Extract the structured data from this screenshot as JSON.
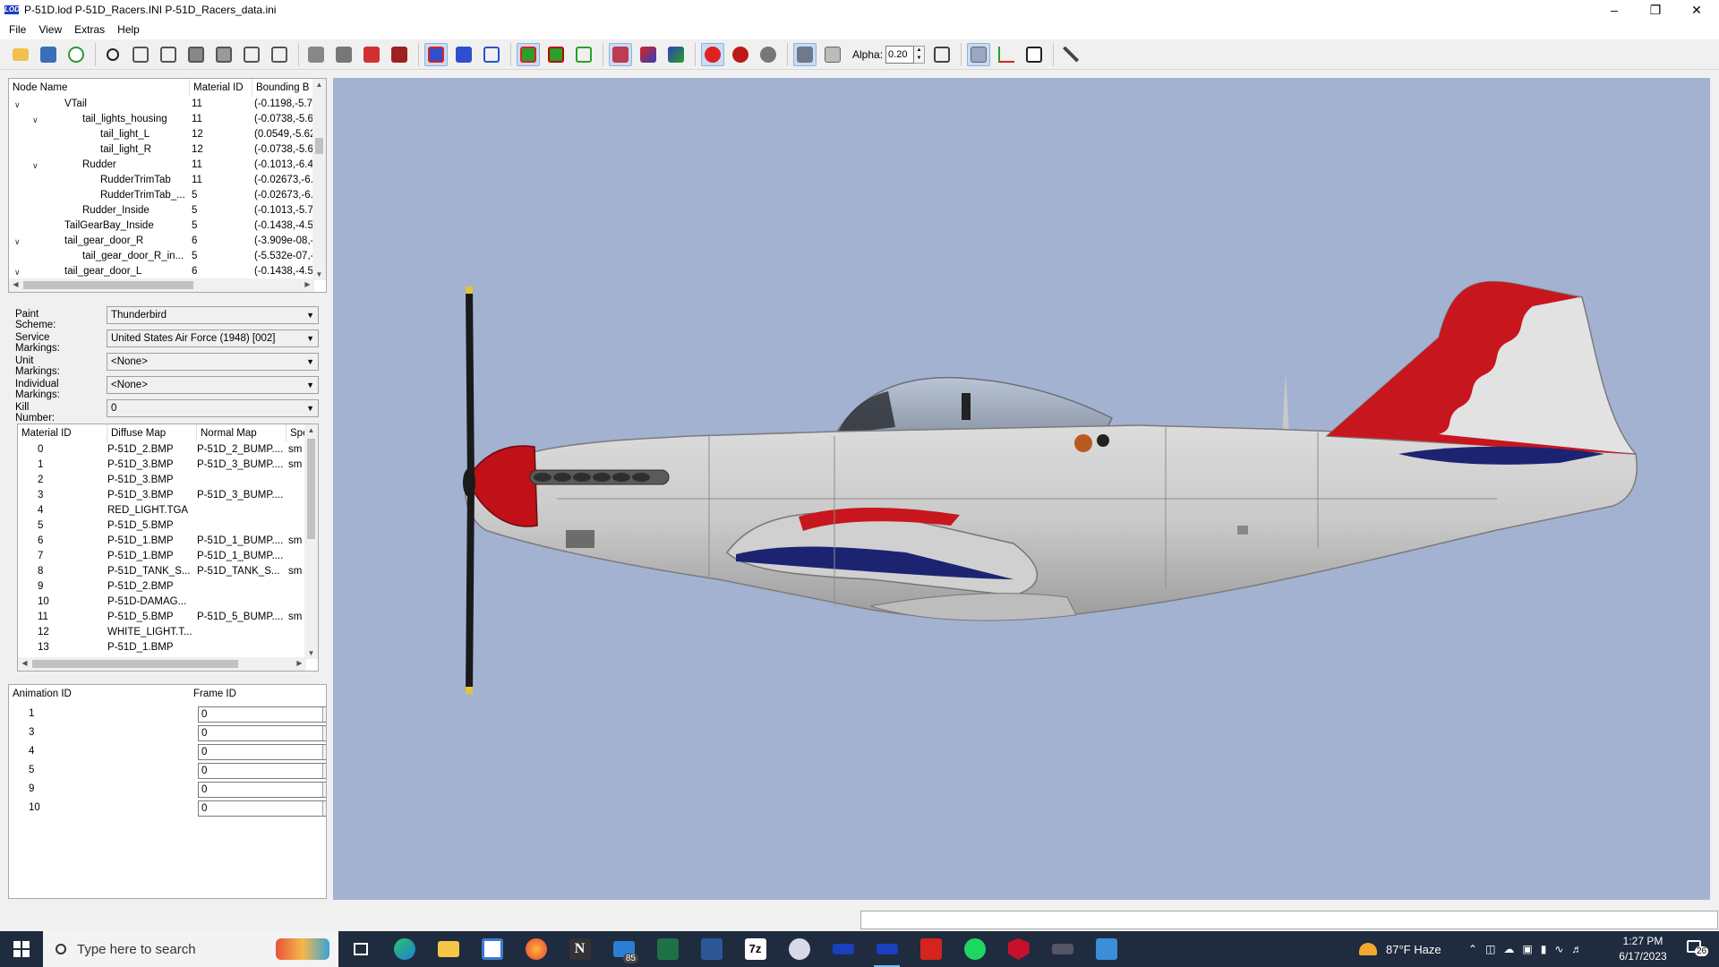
{
  "window": {
    "title": "P-51D.lod  P-51D_Racers.INI  P-51D_Racers_data.ini",
    "logo_text": "LOD"
  },
  "menu": [
    "File",
    "View",
    "Extras",
    "Help"
  ],
  "toolbar": {
    "alpha_label": "Alpha:",
    "alpha_value": "0.20"
  },
  "node_tree": {
    "columns": [
      "Node Name",
      "Material ID",
      "Bounding B"
    ],
    "rows": [
      {
        "name": "VTail",
        "material": "11",
        "bounds": "(-0.1198,-5.7",
        "depth": 2,
        "expanded": true
      },
      {
        "name": "tail_lights_housing",
        "material": "11",
        "bounds": "(-0.0738,-5.6",
        "depth": 3,
        "expanded": true
      },
      {
        "name": "tail_light_L",
        "material": "12",
        "bounds": "(0.0549,-5.62",
        "depth": 4
      },
      {
        "name": "tail_light_R",
        "material": "12",
        "bounds": "(-0.0738,-5.6",
        "depth": 4
      },
      {
        "name": "Rudder",
        "material": "11",
        "bounds": "(-0.1013,-6.4",
        "depth": 3,
        "expanded": true
      },
      {
        "name": "RudderTrimTab",
        "material": "11",
        "bounds": "(-0.02673,-6.",
        "depth": 4
      },
      {
        "name": "RudderTrimTab_...",
        "material": "5",
        "bounds": "(-0.02673,-6.",
        "depth": 4
      },
      {
        "name": "Rudder_Inside",
        "material": "5",
        "bounds": "(-0.1013,-5.7",
        "depth": 3
      },
      {
        "name": "TailGearBay_Inside",
        "material": "5",
        "bounds": "(-0.1438,-4.5",
        "depth": 2
      },
      {
        "name": "tail_gear_door_R",
        "material": "6",
        "bounds": "(-3.909e-08,-",
        "depth": 2,
        "expanded": true
      },
      {
        "name": "tail_gear_door_R_in...",
        "material": "5",
        "bounds": "(-5.532e-07,-",
        "depth": 3
      },
      {
        "name": "tail_gear_door_L",
        "material": "6",
        "bounds": "(-0.1438,-4.5",
        "depth": 2,
        "expanded": true
      }
    ]
  },
  "markings": {
    "paint_scheme_label": "Paint Scheme:",
    "paint_scheme": "Thunderbird",
    "service_label": "Service Markings:",
    "service": "United States Air Force (1948) [002]",
    "unit_label": "Unit Markings:",
    "unit": "<None>",
    "individual_label": "Individual Markings:",
    "individual": "<None>",
    "kill_label": "Kill Number:",
    "kill": "0"
  },
  "materials": {
    "columns": [
      "Material ID",
      "Diffuse Map",
      "Normal Map",
      "Spe"
    ],
    "rows": [
      {
        "id": "0",
        "diffuse": "P-51D_2.BMP",
        "normal": "P-51D_2_BUMP....",
        "spec": "sm"
      },
      {
        "id": "1",
        "diffuse": "P-51D_3.BMP",
        "normal": "P-51D_3_BUMP....",
        "spec": "sm"
      },
      {
        "id": "2",
        "diffuse": "P-51D_3.BMP",
        "normal": "",
        "spec": ""
      },
      {
        "id": "3",
        "diffuse": "P-51D_3.BMP",
        "normal": "P-51D_3_BUMP....",
        "spec": ""
      },
      {
        "id": "4",
        "diffuse": "RED_LIGHT.TGA",
        "normal": "",
        "spec": ""
      },
      {
        "id": "5",
        "diffuse": "P-51D_5.BMP",
        "normal": "",
        "spec": ""
      },
      {
        "id": "6",
        "diffuse": "P-51D_1.BMP",
        "normal": "P-51D_1_BUMP....",
        "spec": "sm"
      },
      {
        "id": "7",
        "diffuse": "P-51D_1.BMP",
        "normal": "P-51D_1_BUMP....",
        "spec": ""
      },
      {
        "id": "8",
        "diffuse": "P-51D_TANK_S...",
        "normal": "P-51D_TANK_S...",
        "spec": "sm"
      },
      {
        "id": "9",
        "diffuse": "P-51D_2.BMP",
        "normal": "",
        "spec": ""
      },
      {
        "id": "10",
        "diffuse": "P-51D-DAMAG...",
        "normal": "",
        "spec": ""
      },
      {
        "id": "11",
        "diffuse": "P-51D_5.BMP",
        "normal": "P-51D_5_BUMP....",
        "spec": "sm"
      },
      {
        "id": "12",
        "diffuse": "WHITE_LIGHT.T...",
        "normal": "",
        "spec": ""
      },
      {
        "id": "13",
        "diffuse": "P-51D_1.BMP",
        "normal": "",
        "spec": ""
      }
    ]
  },
  "animations": {
    "columns": [
      "Animation ID",
      "Frame ID"
    ],
    "rows": [
      {
        "id": "1",
        "frame": "0"
      },
      {
        "id": "3",
        "frame": "0"
      },
      {
        "id": "4",
        "frame": "0"
      },
      {
        "id": "5",
        "frame": "0"
      },
      {
        "id": "9",
        "frame": "0"
      },
      {
        "id": "10",
        "frame": "0"
      }
    ]
  },
  "taskbar": {
    "search_placeholder": "Type here to search",
    "mail_badge": "85",
    "sevenzip_label": "7z",
    "weather": "87°F  Haze",
    "time": "1:27 PM",
    "date": "6/17/2023",
    "notifications": "26"
  },
  "colors": {
    "viewport_bg": "#a4b2d2",
    "taskbar_bg": "#1f2b3e",
    "thunderbird_red": "#c8161e",
    "thunderbird_blue": "#1c2472"
  }
}
